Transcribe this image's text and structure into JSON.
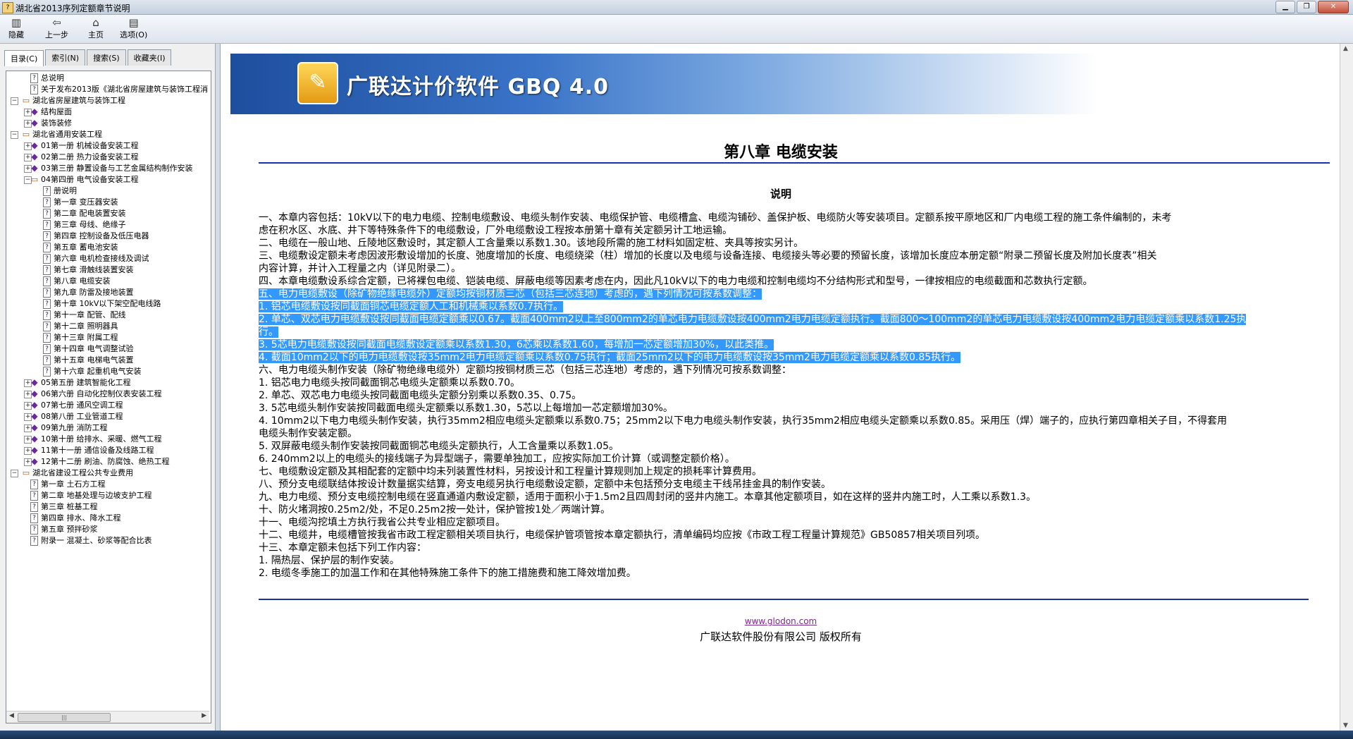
{
  "window": {
    "title": "湖北省2013序列定额章节说明",
    "minimize": "▁",
    "maximize": "❐",
    "close": "✕"
  },
  "toolbar": [
    {
      "label": "隐藏",
      "icon": "▥"
    },
    {
      "label": "上一步",
      "icon": "⇦"
    },
    {
      "label": "主页",
      "icon": "⌂"
    },
    {
      "label": "选项(O)",
      "icon": "▤"
    }
  ],
  "tabs": [
    "目录(C)",
    "索引(N)",
    "搜索(S)",
    "收藏夹(I)"
  ],
  "tree": [
    {
      "level": 1,
      "type": "page",
      "exp": "",
      "label": "总说明"
    },
    {
      "level": 1,
      "type": "page",
      "exp": "",
      "label": "关于发布2013版《湖北省房屋建筑与装饰工程消"
    },
    {
      "level": 0,
      "type": "openbook",
      "exp": "−",
      "label": "湖北省房屋建筑与装饰工程"
    },
    {
      "level": 1,
      "type": "book",
      "exp": "+",
      "label": "结构屋面"
    },
    {
      "level": 1,
      "type": "book",
      "exp": "+",
      "label": "装饰装修"
    },
    {
      "level": 0,
      "type": "openbook",
      "exp": "−",
      "label": "湖北省通用安装工程"
    },
    {
      "level": 1,
      "type": "book",
      "exp": "+",
      "label": "01第一册 机械设备安装工程"
    },
    {
      "level": 1,
      "type": "book",
      "exp": "+",
      "label": "02第二册 热力设备安装工程"
    },
    {
      "level": 1,
      "type": "book",
      "exp": "+",
      "label": "03第三册 静置设备与工艺金属结构制作安装"
    },
    {
      "level": 1,
      "type": "openbook",
      "exp": "−",
      "label": "04第四册 电气设备安装工程"
    },
    {
      "level": 2,
      "type": "page",
      "exp": "",
      "label": "册说明"
    },
    {
      "level": 2,
      "type": "page",
      "exp": "",
      "label": "第一章 变压器安装"
    },
    {
      "level": 2,
      "type": "page",
      "exp": "",
      "label": "第二章 配电装置安装"
    },
    {
      "level": 2,
      "type": "page",
      "exp": "",
      "label": "第三章 母线、绝缘子"
    },
    {
      "level": 2,
      "type": "page",
      "exp": "",
      "label": "第四章 控制设备及低压电器"
    },
    {
      "level": 2,
      "type": "page",
      "exp": "",
      "label": "第五章 蓄电池安装"
    },
    {
      "level": 2,
      "type": "page",
      "exp": "",
      "label": "第六章 电机检查接线及调试"
    },
    {
      "level": 2,
      "type": "page",
      "exp": "",
      "label": "第七章 滑触线装置安装"
    },
    {
      "level": 2,
      "type": "page",
      "exp": "",
      "label": "第八章 电缆安装"
    },
    {
      "level": 2,
      "type": "page",
      "exp": "",
      "label": "第九章 防雷及接地装置"
    },
    {
      "level": 2,
      "type": "page",
      "exp": "",
      "label": "第十章 10kV以下架空配电线路"
    },
    {
      "level": 2,
      "type": "page",
      "exp": "",
      "label": "第十一章 配管、配线"
    },
    {
      "level": 2,
      "type": "page",
      "exp": "",
      "label": "第十二章 照明器具"
    },
    {
      "level": 2,
      "type": "page",
      "exp": "",
      "label": "第十三章 附属工程"
    },
    {
      "level": 2,
      "type": "page",
      "exp": "",
      "label": "第十四章 电气调整试验"
    },
    {
      "level": 2,
      "type": "page",
      "exp": "",
      "label": "第十五章 电梯电气装置"
    },
    {
      "level": 2,
      "type": "page",
      "exp": "",
      "label": "第十六章 起重机电气安装"
    },
    {
      "level": 1,
      "type": "book",
      "exp": "+",
      "label": "05第五册 建筑智能化工程"
    },
    {
      "level": 1,
      "type": "book",
      "exp": "+",
      "label": "06第六册 自动化控制仪表安装工程"
    },
    {
      "level": 1,
      "type": "book",
      "exp": "+",
      "label": "07第七册 通风空调工程"
    },
    {
      "level": 1,
      "type": "book",
      "exp": "+",
      "label": "08第八册 工业管道工程"
    },
    {
      "level": 1,
      "type": "book",
      "exp": "+",
      "label": "09第九册 消防工程"
    },
    {
      "level": 1,
      "type": "book",
      "exp": "+",
      "label": "10第十册 给排水、采暖、燃气工程"
    },
    {
      "level": 1,
      "type": "book",
      "exp": "+",
      "label": "11第十一册 通信设备及线路工程"
    },
    {
      "level": 1,
      "type": "book",
      "exp": "+",
      "label": "12第十二册 刷油、防腐蚀、绝热工程"
    },
    {
      "level": 0,
      "type": "openbook",
      "exp": "−",
      "label": "湖北省建设工程公共专业费用"
    },
    {
      "level": 1,
      "type": "page",
      "exp": "",
      "label": "第一章 土石方工程"
    },
    {
      "level": 1,
      "type": "page",
      "exp": "",
      "label": "第二章 地基处理与边坡支护工程"
    },
    {
      "level": 1,
      "type": "page",
      "exp": "",
      "label": "第三章 桩基工程"
    },
    {
      "level": 1,
      "type": "page",
      "exp": "",
      "label": "第四章 排水、降水工程"
    },
    {
      "level": 1,
      "type": "page",
      "exp": "",
      "label": "第五章 预拌砂浆"
    },
    {
      "level": 1,
      "type": "page",
      "exp": "",
      "label": "附录一 混凝土、砂浆等配合比表"
    }
  ],
  "content": {
    "brand": "广联达计价软件 GBQ 4.0",
    "chapter_title": "第八章 电缆安装",
    "subtitle": "说明",
    "lines": [
      {
        "text": "一、本章内容包括：10kV以下的电力电缆、控制电缆敷设、电缆头制作安装、电缆保护管、电缆槽盒、电缆沟铺砂、盖保护板、电缆防火等安装项目。定额系按平原地区和厂内电缆工程的施工条件编制的，未考",
        "sel": false
      },
      {
        "text": "虑在积水区、水底、井下等特殊条件下的电缆敷设，厂外电缆敷设工程按本册第十章有关定额另计工地运输。",
        "sel": false
      },
      {
        "text": "二、电缆在一般山地、丘陵地区敷设时，其定额人工含量乘以系数1.30。该地段所需的施工材料如固定桩、夹具等按实另计。",
        "sel": false
      },
      {
        "text": "三、电缆敷设定额未考虑因波形敷设增加的长度、弛度增加的长度、电缆绕梁（柱）增加的长度以及电缆与设备连接、电缆接头等必要的预留长度，该增加长度应本册定额“附录二预留长度及附加长度表”相关",
        "sel": false
      },
      {
        "text": "内容计算，并计入工程量之内（详见附录二）。",
        "sel": false
      },
      {
        "text": "四、本章电缆敷设系综合定额，已将裸包电缆、铠装电缆、屏蔽电缆等因素考虑在内，因此凡10kV以下的电力电缆和控制电缆均不分结构形式和型号，一律按相应的电缆截面和芯数执行定额。",
        "sel": false
      },
      {
        "text": "五、电力电缆敷设（除矿物绝缘电缆外）定额均按铜材质三芯（包括三芯连地）考虑的，遇下列情况可按系数调整：",
        "sel": true
      },
      {
        "text": "1. 铝芯电缆敷设按同截面铜芯电缆定额人工和机械乘以系数0.7执行。",
        "sel": true
      },
      {
        "text": "2. 单芯、双芯电力电缆敷设按同截面电缆定额乘以0.67。截面400mm2以上至800mm2的单芯电力电缆敷设按400mm2电力电缆定额执行。截面800～100mm2的单芯电力电缆敷设按400mm2电力电缆定额乘以系数1.25执",
        "sel": true
      },
      {
        "text": "行。",
        "sel": true
      },
      {
        "text": "3. 5芯电力电缆敷设按同截面电缆敷设定额乘以系数1.30，6芯乘以系数1.60，每增加一芯定额增加30%，以此类推。",
        "sel": true
      },
      {
        "text": "4. 截面10mm2以下的电力电缆敷设按35mm2电力电缆定额乘以系数0.75执行；截面25mm2以下的电力电缆敷设按35mm2电力电缆定额乘以系数0.85执行。",
        "sel": true
      },
      {
        "text": "六、电力电缆头制作安装（除矿物绝缘电缆外）定额均按铜材质三芯（包括三芯连地）考虑的，遇下列情况可按系数调整：",
        "sel": false
      },
      {
        "text": "1. 铝芯电力电缆头按同截面铜芯电缆头定额乘以系数0.70。",
        "sel": false
      },
      {
        "text": "2. 单芯、双芯电力电缆头按同截面电缆头定额分别乘以系数0.35、0.75。",
        "sel": false
      },
      {
        "text": "3. 5芯电缆头制作安装按同截面电缆头定额乘以系数1.30，5芯以上每增加一芯定额增加30%。",
        "sel": false
      },
      {
        "text": "4. 10mm2以下电力电缆头制作安装，执行35mm2相应电缆头定额乘以系数0.75；25mm2以下电力电缆头制作安装，执行35mm2相应电缆头定额乘以系数0.85。采用压（焊）端子的，应执行第四章相关子目，不得套用",
        "sel": false
      },
      {
        "text": "电缆头制作安装定额。",
        "sel": false
      },
      {
        "text": "5. 双屏蔽电缆头制作安装按同截面铜芯电缆头定额执行，人工含量乘以系数1.05。",
        "sel": false
      },
      {
        "text": "6. 240mm2以上的电缆头的接线端子为异型端子，需要单独加工，应按实际加工价计算（或调整定额价格）。",
        "sel": false
      },
      {
        "text": "七、电缆敷设定额及其相配套的定额中均未列装置性材料，另按设计和工程量计算规则加上规定的损耗率计算费用。",
        "sel": false
      },
      {
        "text": "八、预分支电缆联结体按设计数量据实结算，旁支电缆另执行电缆敷设定额，定额中未包括预分支电缆主干线吊挂金具的制作安装。",
        "sel": false
      },
      {
        "text": "九、电力电缆、预分支电缆控制电缆在竖直通道内敷设定额，适用于面积小于1.5m2且四周封闭的竖井内施工。本章其他定额项目，如在这样的竖井内施工时，人工乘以系数1.3。",
        "sel": false
      },
      {
        "text": "十、防火堵洞按0.25m2/处，不足0.25m2按一处计，保护管按1处／两端计算。",
        "sel": false
      },
      {
        "text": "十一、电缆沟挖填土方执行我省公共专业相应定额项目。",
        "sel": false
      },
      {
        "text": "十二、电缆井，电缆槽管按我省市政工程定额相关项目执行，电缆保护管项管按本章定额执行，清单编码均应按《市政工程工程量计算规范》GB50857相关项目列项。",
        "sel": false
      },
      {
        "text": "十三、本章定额未包括下列工作内容：",
        "sel": false
      },
      {
        "text": "1. 隔热层、保护层的制作安装。",
        "sel": false
      },
      {
        "text": "2. 电缆冬季施工的加温工作和在其他特殊施工条件下的施工措施费和施工降效增加费。",
        "sel": false
      }
    ],
    "footer_url": "www.glodon.com",
    "footer_copyright": "广联达软件股份有限公司 版权所有"
  }
}
